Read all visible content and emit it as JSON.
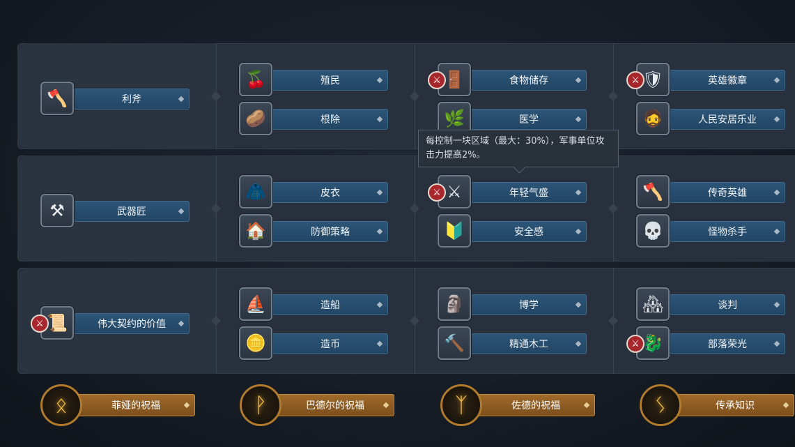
{
  "rows": [
    {
      "base": {
        "label": "利斧",
        "icon": "axe-wood-icon",
        "locked": false
      },
      "columns": [
        [
          {
            "label": "殖民",
            "icon": "berries-bowl-icon",
            "locked": false
          },
          {
            "label": "根除",
            "icon": "sack-icon",
            "locked": false
          }
        ],
        [
          {
            "label": "食物储存",
            "icon": "storehouse-icon",
            "locked": true
          },
          {
            "label": "医学",
            "icon": "herb-icon",
            "locked": false
          }
        ],
        [
          {
            "label": "英雄徽章",
            "icon": "hero-badge-icon",
            "locked": true
          },
          {
            "label": "人民安居乐业",
            "icon": "bearded-man-icon",
            "locked": false
          }
        ]
      ]
    },
    {
      "base": {
        "label": "武器匠",
        "icon": "anvil-icon",
        "locked": false
      },
      "columns": [
        [
          {
            "label": "皮衣",
            "icon": "leather-icon",
            "locked": false
          },
          {
            "label": "防御策略",
            "icon": "watchtower-icon",
            "locked": false
          }
        ],
        [
          {
            "label": "年轻气盛",
            "icon": "crossed-swords-icon",
            "locked": true
          },
          {
            "label": "安全感",
            "icon": "chevron-shield-icon",
            "locked": false
          }
        ],
        [
          {
            "label": "传奇英雄",
            "icon": "battle-axe-icon",
            "locked": false
          },
          {
            "label": "怪物杀手",
            "icon": "skull-icon",
            "locked": false
          }
        ]
      ]
    },
    {
      "base": {
        "label": "伟大契约的价值",
        "icon": "pact-icon",
        "locked": true
      },
      "columns": [
        [
          {
            "label": "造船",
            "icon": "longship-icon",
            "locked": false
          },
          {
            "label": "造币",
            "icon": "coin-icon",
            "locked": false
          }
        ],
        [
          {
            "label": "博学",
            "icon": "rune-stone-icon",
            "locked": false
          },
          {
            "label": "精通木工",
            "icon": "hammer-icon",
            "locked": false
          }
        ],
        [
          {
            "label": "谈判",
            "icon": "town-icon",
            "locked": false
          },
          {
            "label": "部落荣光",
            "icon": "golden-beast-icon",
            "locked": true
          }
        ]
      ]
    }
  ],
  "tooltip": {
    "text": "每控制一块区域（最大：30%），军事单位攻击力提高2%。"
  },
  "blessings": [
    {
      "label": "菲娅的祝福",
      "rune": "ᛟ"
    },
    {
      "label": "巴德尔的祝福",
      "rune": "ᚹ"
    },
    {
      "label": "佐德的祝福",
      "rune": "ᛉ"
    },
    {
      "label": "传承知识",
      "rune": "ᛊ"
    }
  ],
  "lock_glyph": "⚔",
  "icon_glyphs": {
    "axe-wood-icon": "🪓",
    "berries-bowl-icon": "🍒",
    "sack-icon": "🥔",
    "storehouse-icon": "🚪",
    "herb-icon": "🌿",
    "hero-badge-icon": "🛡",
    "bearded-man-icon": "🧔",
    "anvil-icon": "⚒",
    "leather-icon": "🧥",
    "watchtower-icon": "🏠",
    "crossed-swords-icon": "⚔",
    "chevron-shield-icon": "🔰",
    "battle-axe-icon": "🪓",
    "skull-icon": "💀",
    "pact-icon": "📜",
    "longship-icon": "⛵",
    "coin-icon": "🪙",
    "rune-stone-icon": "🗿",
    "hammer-icon": "🔨",
    "town-icon": "🏘",
    "golden-beast-icon": "🐉"
  }
}
